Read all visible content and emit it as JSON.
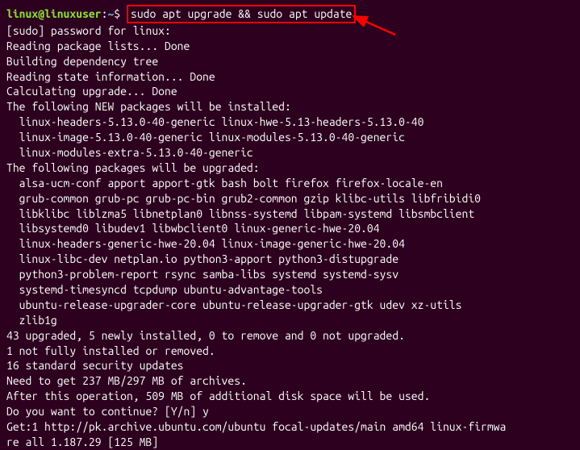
{
  "prompt": {
    "user_host": "linux@linuxuser",
    "colon": ":",
    "path": "~",
    "dollar": "$ ",
    "command": "sudo apt upgrade && sudo apt update"
  },
  "lines": [
    "[sudo] password for linux:",
    "Reading package lists... Done",
    "Building dependency tree",
    "Reading state information... Done",
    "Calculating upgrade... Done",
    "The following NEW packages will be installed:",
    "  linux-headers-5.13.0-40-generic linux-hwe-5.13-headers-5.13.0-40",
    "  linux-image-5.13.0-40-generic linux-modules-5.13.0-40-generic",
    "  linux-modules-extra-5.13.0-40-generic",
    "The following packages will be upgraded:",
    "  alsa-ucm-conf apport apport-gtk bash bolt firefox firefox-locale-en",
    "  grub-common grub-pc grub-pc-bin grub2-common gzip klibc-utils libfribidi0",
    "  libklibc liblzma5 libnetplan0 libnss-systemd libpam-systemd libsmbclient",
    "  libsystemd0 libudev1 libwbclient0 linux-generic-hwe-20.04",
    "  linux-headers-generic-hwe-20.04 linux-image-generic-hwe-20.04",
    "  linux-libc-dev netplan.io python3-apport python3-distupgrade",
    "  python3-problem-report rsync samba-libs systemd systemd-sysv",
    "  systemd-timesyncd tcpdump ubuntu-advantage-tools",
    "  ubuntu-release-upgrader-core ubuntu-release-upgrader-gtk udev xz-utils",
    "  zlib1g",
    "43 upgraded, 5 newly installed, 0 to remove and 0 not upgraded.",
    "1 not fully installed or removed.",
    "16 standard security updates",
    "Need to get 237 MB/297 MB of archives.",
    "After this operation, 509 MB of additional disk space will be used.",
    "Do you want to continue? [Y/n] y",
    "Get:1 http://pk.archive.ubuntu.com/ubuntu focal-updates/main amd64 linux-firmwa",
    "re all 1.187.29 [125 MB]"
  ]
}
